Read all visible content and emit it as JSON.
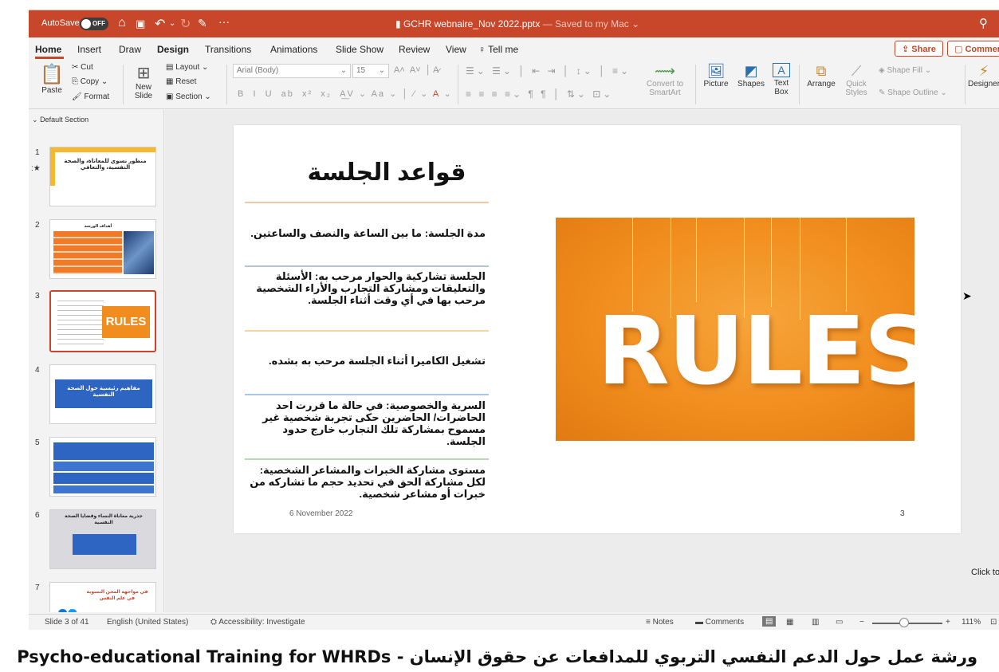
{
  "colors": {
    "accent": "#c8462a",
    "rules_bg": "#f18d1e"
  },
  "titlebar": {
    "autosave_label": "AutoSave",
    "autosave_state": "OFF",
    "doc_name": "GCHR webnaire_Nov 2022.pptx",
    "saved_status": "— Saved to my Mac",
    "icons": [
      "home-icon",
      "save-icon",
      "undo-icon",
      "redo-icon",
      "edit-icon",
      "more-icon",
      "search-icon"
    ]
  },
  "tabs": [
    "Home",
    "Insert",
    "Draw",
    "Design",
    "Transitions",
    "Animations",
    "Slide Show",
    "Review",
    "View",
    "Tell me"
  ],
  "share_label": "Share",
  "comments_label": "Commer",
  "ribbon": {
    "paste": "Paste",
    "cut": "Cut",
    "copy": "Copy",
    "format": "Format",
    "new_slide": "New",
    "new_slide_2": "Slide",
    "layout": "Layout",
    "reset": "Reset",
    "section": "Section",
    "font_name": "Arial (Body)",
    "font_size": "15",
    "convert_smartart": "Convert to",
    "convert_smartart_2": "SmartArt",
    "picture": "Picture",
    "shapes": "Shapes",
    "text_box": "Text",
    "text_box_2": "Box",
    "arrange": "Arrange",
    "quick_styles": "Quick",
    "quick_styles_2": "Styles",
    "shape_fill": "Shape Fill",
    "shape_outline": "Shape Outline",
    "designer": "Designer"
  },
  "thumbs": {
    "section_label": "Default Section",
    "slides": [
      {
        "num": "1",
        "text": "منظور نسوي للمعاناة، والصحة النفسية، والتعافي"
      },
      {
        "num": "2",
        "text": "أهداف الورشة"
      },
      {
        "num": "3",
        "text": "RULES"
      },
      {
        "num": "4",
        "text": "مفاهيم رئيسية حول الصحة النفسية"
      },
      {
        "num": "5",
        "text": ""
      },
      {
        "num": "6",
        "text": "جذرية معاناة النساء وقضايا الصحة النفسية"
      },
      {
        "num": "7",
        "text": "في مواجهة المحن النسوية في علم النفس"
      }
    ]
  },
  "slide": {
    "title": "قواعد الجلسة",
    "rules": [
      "مدة الجلسة: ما بين الساعة والنصف والساعتين.",
      "الجلسة تشاركية والحوار مرحب به: الأسئلة والتعليقات ومشاركة التجارب والأراء الشخصية مرحب بها في أي وقت أثناء الجلسة.",
      "تشغيل الكاميرا أثناء الجلسة مرحب به بشده.",
      "السرية والخصوصية: في حالة ما قررت احد الحاضرات/ الحاضرين حكى تجربة شخصية غير مسموح بمشاركة تلك التجارب خارج حدود الجلسة.",
      "مستوى مشاركة الخبرات والمشاعر الشخصية: لكل مشاركة الحق في تحديد حجم ما تشاركه من خبرات أو مشاعر شخصية."
    ],
    "rules_image_text": "RULES",
    "date": "6 November 2022",
    "page_number": "3"
  },
  "notes_hint": "Click to add no",
  "status": {
    "slide_count": "Slide 3 of 41",
    "language": "English (United States)",
    "accessibility": "Accessibility: Investigate",
    "notes": "Notes",
    "comments": "Comments",
    "zoom": "111%"
  },
  "caption": "ورشة عمل حول الدعم النفسي التربوي للمدافعات عن حقوق الإنسان - Psycho-educational Training for WHRDs"
}
